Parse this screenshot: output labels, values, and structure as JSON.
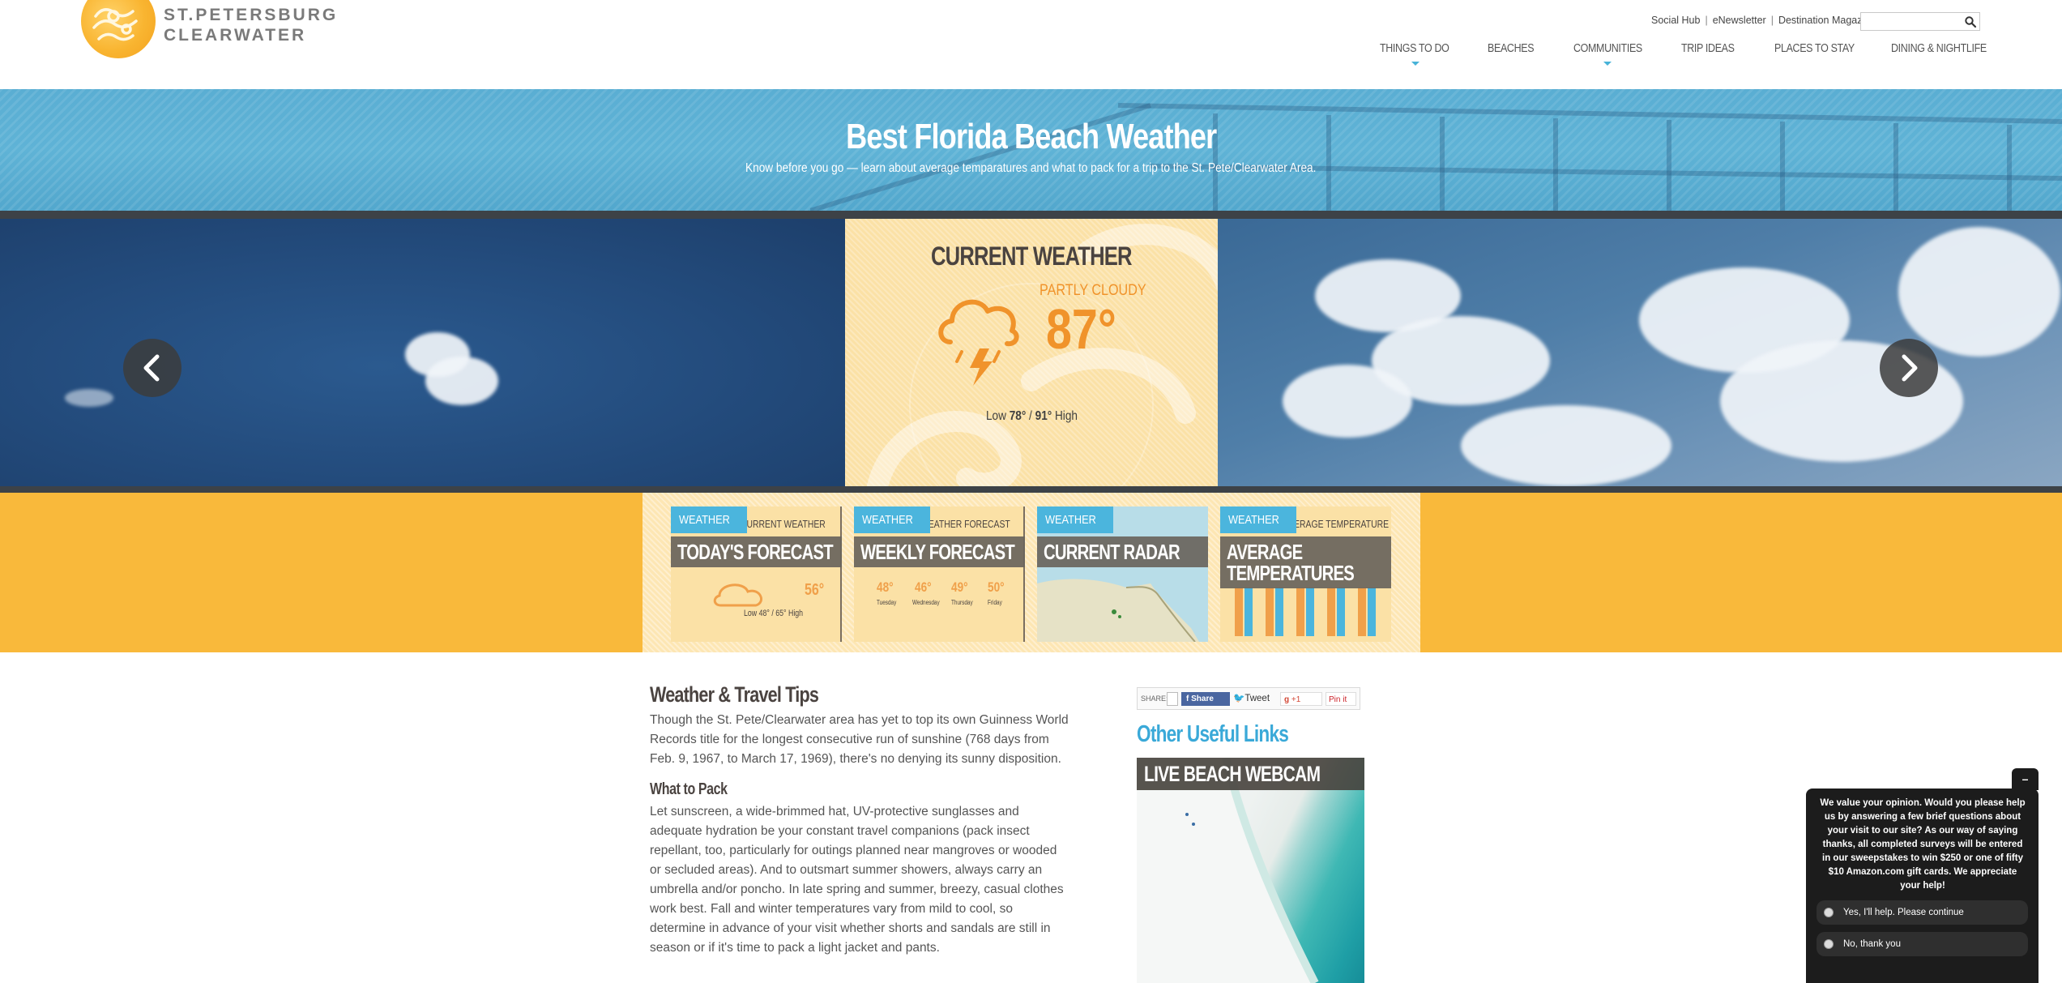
{
  "header": {
    "logo_line1": "ST.PETERSBURG",
    "logo_line2": "CLEARWATER",
    "util_links": [
      "Social Hub",
      "eNewsletter",
      "Destination Magazine"
    ],
    "search": {
      "placeholder": "",
      "icon": "search-icon"
    },
    "nav": [
      {
        "label": "THINGS TO DO",
        "has_dropdown": true
      },
      {
        "label": "BEACHES",
        "has_dropdown": false
      },
      {
        "label": "COMMUNITIES",
        "has_dropdown": true
      },
      {
        "label": "TRIP IDEAS",
        "has_dropdown": false
      },
      {
        "label": "PLACES TO STAY",
        "has_dropdown": false
      },
      {
        "label": "DINING & NIGHTLIFE",
        "has_dropdown": false
      }
    ]
  },
  "hero": {
    "title": "Best Florida Beach Weather",
    "subtitle": "Know before you go — learn about average temparatures and what to pack for a trip to the St. Pete/Clearwater Area."
  },
  "current_weather": {
    "title": "CURRENT WEATHER",
    "condition": "PARTLY CLOUDY",
    "temperature": "87°",
    "low_label": "Low",
    "low": "78°",
    "high": "91°",
    "high_label": "High",
    "icon": "thunderstorm-icon"
  },
  "slider": {
    "prev_icon": "chevron-left-icon",
    "next_icon": "chevron-right-icon"
  },
  "tiles": [
    {
      "tag": "WEATHER",
      "title": "TODAY'S FORECAST",
      "bg_caption": "CURRENT WEATHER",
      "bg_temp": "56°",
      "bg_lowhigh": "Low 48° / 65° High"
    },
    {
      "tag": "WEATHER",
      "title": "WEEKLY FORECAST",
      "bg_caption": "WEATHER FORECAST",
      "bg_temps": [
        "48°",
        "46°",
        "49°",
        "50°"
      ],
      "bg_days": [
        "Tuesday",
        "Wednesday",
        "Thursday",
        "Friday"
      ]
    },
    {
      "tag": "WEATHER",
      "title": "CURRENT RADAR"
    },
    {
      "tag": "WEATHER",
      "title_line1": "AVERAGE",
      "title_line2": "TEMPERATURES",
      "bg_caption": "AVERAGE TEMPERATURE"
    }
  ],
  "article": {
    "heading": "Weather & Travel Tips",
    "intro": "Though the St. Pete/Clearwater area has yet to top its own Guinness World Records title for the longest consecutive run of sunshine (768 days from Feb. 9, 1967, to March 17, 1969), there's no denying its sunny disposition.",
    "pack_heading": "What to Pack",
    "pack_text": "Let sunscreen, a wide-brimmed hat, UV-protective sunglasses and adequate hydration be your constant travel companions (pack insect repellant, too, particularly for outings planned near mangroves or wooded or secluded areas). And to outsmart summer showers, always carry an umbrella and/or poncho. In late spring and summer, breezy, casual clothes work best. Fall and winter temperatures vary from mild to cool, so determine in advance of your visit whether shorts and sandals are still in season or if it's time to pack a light jacket and pants."
  },
  "sidebar": {
    "share_label": "SHARE:",
    "share_facebook": "Share",
    "share_twitter": "Tweet",
    "share_gplus": "+1",
    "share_pinterest": "Pin it",
    "links_title": "Other Useful Links",
    "webcam_title": "LIVE BEACH WEBCAM"
  },
  "survey": {
    "close": "–",
    "message": "We value your opinion. Would you please help us by answering a few brief questions about your visit to our site? As our way of saying thanks, all completed surveys will be entered in our sweepstakes to win $250 or one of fifty $10 Amazon.com gift cards. We appreciate your help!",
    "option_yes": "Yes, I'll help. Please continue",
    "option_no": "No, thank you"
  },
  "colors": {
    "accent_blue": "#48b3d8",
    "orange": "#f0932b",
    "strip_yellow": "#f9b93b"
  }
}
